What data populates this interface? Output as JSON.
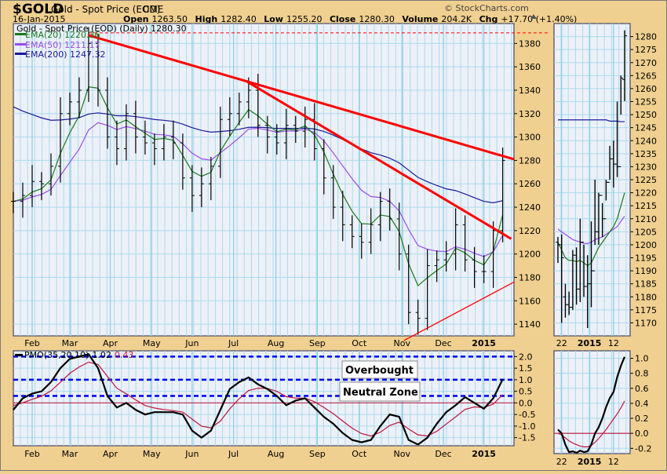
{
  "header": {
    "symbol": "$GOLD",
    "name": "Gold - Spot Price (EOD)",
    "exchange": "CME",
    "date": "16-Jan-2015",
    "copyright": "© StockCharts.com",
    "open_label": "Open",
    "open": "1263.50",
    "high_label": "High",
    "high": "1282.40",
    "low_label": "Low",
    "low": "1255.20",
    "close_label": "Close",
    "close": "1280.30",
    "volume_label": "Volume",
    "volume": "204.2K",
    "chg_label": "Chg",
    "chg": "+17.70 (+1.40%)",
    "chg_icon": "up-triangle-icon"
  },
  "colors": {
    "bg": "#f0d090",
    "panel": "#eef0f8",
    "ema20": "#1a7a1a",
    "ema50": "#9a4ce8",
    "ema200": "#1a1a9a",
    "trend": "#ff0000",
    "pmo": "#000000",
    "signal": "#c0143c",
    "zone": "#0000ee"
  },
  "chart_data": [
    {
      "type": "ohlc",
      "title": "Gold - Spot Price (EOD) (Daily) 1280.30",
      "legend": [
        "EMA(20) 1220.36",
        "EMA(50) 1211.17",
        "EMA(200) 1247.32"
      ],
      "legend_placement": "top-left",
      "x_ticks": [
        {
          "i": 2,
          "label": "Feb"
        },
        {
          "i": 6,
          "label": "Mar"
        },
        {
          "i": 10.3,
          "label": "Apr"
        },
        {
          "i": 14.7,
          "label": "May"
        },
        {
          "i": 19,
          "label": "Jun"
        },
        {
          "i": 23.4,
          "label": "Jul"
        },
        {
          "i": 27.9,
          "label": "Aug"
        },
        {
          "i": 32.3,
          "label": "Sep"
        },
        {
          "i": 36.75,
          "label": "Oct"
        },
        {
          "i": 41.3,
          "label": "Nov"
        },
        {
          "i": 45.7,
          "label": "Dec"
        },
        {
          "i": 50,
          "label": "2015"
        }
      ],
      "x_range": [
        0,
        53.2
      ],
      "ylim": [
        1130,
        1397
      ],
      "y_ticks": [
        1140,
        1160,
        1180,
        1200,
        1220,
        1240,
        1260,
        1280,
        1300,
        1320,
        1340,
        1360,
        1380
      ],
      "weekly_close": [
        1245,
        1250,
        1262,
        1260,
        1275,
        1320,
        1330,
        1340,
        1380,
        1340,
        1300,
        1290,
        1320,
        1300,
        1295,
        1290,
        1300,
        1295,
        1265,
        1250,
        1260,
        1275,
        1315,
        1320,
        1330,
        1340,
        1310,
        1300,
        1295,
        1310,
        1305,
        1315,
        1290,
        1265,
        1240,
        1225,
        1215,
        1210,
        1225,
        1245,
        1230,
        1200,
        1150,
        1145,
        1190,
        1195,
        1200,
        1225,
        1195,
        1185,
        1185,
        1220,
        1280
      ],
      "ema_seed": {
        "ema20": 1245,
        "ema50": 1245,
        "ema200": 1330
      },
      "ema_periods_weeks": {
        "ema20": 4,
        "ema50": 10,
        "ema200": 40
      },
      "trendlines": [
        {
          "from": [
            8,
            1387
          ],
          "to": [
            53.2,
            1281
          ],
          "width": "thick"
        },
        {
          "from": [
            24.7,
            1348
          ],
          "to": [
            52.9,
            1213
          ],
          "width": "thick"
        },
        {
          "from": [
            41.5,
            1126
          ],
          "to": [
            53.2,
            1176
          ],
          "width": "thin"
        }
      ],
      "dashed_level": 1389
    },
    {
      "type": "line",
      "title": "PMO(35,20,10)",
      "pmo_value": "1.02",
      "signal_value": "0.43",
      "ylim": [
        -1.85,
        2.25
      ],
      "y_ticks": [
        -1.5,
        -1.0,
        -0.5,
        0.0,
        0.5,
        1.0,
        1.5,
        2.0
      ],
      "zone_lines": [
        2.0,
        1.0,
        0.3
      ],
      "annotations": [
        "Overbought",
        "Neutral Zone"
      ],
      "pmo": [
        -0.3,
        0.2,
        0.4,
        0.5,
        0.9,
        1.5,
        1.9,
        2.0,
        2.1,
        1.5,
        0.3,
        -0.2,
        0.0,
        -0.3,
        -0.5,
        -0.4,
        -0.4,
        -0.4,
        -0.5,
        -1.2,
        -1.5,
        -1.2,
        -0.3,
        0.6,
        0.9,
        1.1,
        0.8,
        0.6,
        0.3,
        -0.1,
        0.1,
        0.2,
        -0.2,
        -0.6,
        -0.9,
        -1.3,
        -1.6,
        -1.7,
        -1.6,
        -1.0,
        -0.5,
        -0.6,
        -1.6,
        -1.8,
        -1.5,
        -0.9,
        -0.4,
        -0.1,
        0.25,
        0.0,
        -0.25,
        0.2,
        1.02
      ]
    },
    {
      "type": "ohlc",
      "title": "Gold daily detail",
      "x_ticks": [
        {
          "i": 1,
          "label": "22"
        },
        {
          "i": 8.5,
          "label": "2015"
        },
        {
          "i": 15,
          "label": "12"
        }
      ],
      "ylim": [
        1165,
        1285
      ],
      "y_ticks": [
        1170,
        1175,
        1180,
        1185,
        1190,
        1195,
        1200,
        1205,
        1210,
        1215,
        1220,
        1225,
        1230,
        1235,
        1240,
        1245,
        1250,
        1255,
        1260,
        1265,
        1270,
        1275,
        1280
      ],
      "bars": [
        [
          1201,
          1203,
          1193,
          1200
        ],
        [
          1200,
          1204,
          1170,
          1195
        ],
        [
          1180,
          1185,
          1172,
          1177
        ],
        [
          1177,
          1182,
          1173,
          1176
        ],
        [
          1176,
          1198,
          1175,
          1196
        ],
        [
          1196,
          1199,
          1177,
          1183
        ],
        [
          1183,
          1210,
          1178,
          1201
        ],
        [
          1201,
          1200,
          1180,
          1184
        ],
        [
          1184,
          1196,
          1168,
          1185
        ],
        [
          1185,
          1209,
          1176,
          1190
        ],
        [
          1190,
          1225,
          1200,
          1205
        ],
        [
          1205,
          1220,
          1200,
          1219
        ],
        [
          1219,
          1216,
          1203,
          1210
        ],
        [
          1210,
          1225,
          1217,
          1224
        ],
        [
          1224,
          1238,
          1225,
          1233
        ],
        [
          1233,
          1240,
          1222,
          1231
        ],
        [
          1231,
          1255,
          1226,
          1230
        ],
        [
          1230,
          1265,
          1250,
          1264
        ],
        [
          1263.5,
          1282.4,
          1255.2,
          1280.3
        ]
      ],
      "ema20": [
        1201,
        1198,
        1195,
        1194,
        1194,
        1193.5,
        1194,
        1193,
        1192,
        1193,
        1196,
        1199,
        1201,
        1203,
        1205,
        1207,
        1210,
        1215,
        1220
      ],
      "ema50": [
        1206,
        1205,
        1204,
        1203,
        1202,
        1201.5,
        1201,
        1200.5,
        1200.5,
        1201,
        1202,
        1202.5,
        1203,
        1204,
        1205,
        1206,
        1207,
        1209,
        1211
      ],
      "ema200": [
        1248,
        1248,
        1248,
        1248,
        1248,
        1248,
        1248,
        1248,
        1248,
        1248,
        1248,
        1248,
        1248,
        1248,
        1247.5,
        1247.5,
        1247.5,
        1247.3,
        1247.3
      ]
    },
    {
      "type": "line",
      "title": "PMO daily detail",
      "ylim": [
        -0.27,
        1.1
      ],
      "y_ticks": [
        -0.2,
        0.0,
        0.2,
        0.4,
        0.6,
        0.8,
        1.0
      ],
      "pmo": [
        0.05,
        0.0,
        -0.15,
        -0.25,
        -0.24,
        -0.26,
        -0.23,
        -0.25,
        -0.24,
        -0.15,
        0.0,
        0.08,
        0.2,
        0.35,
        0.47,
        0.55,
        0.75,
        0.9,
        1.02
      ],
      "signal": [
        0.0,
        -0.02,
        -0.06,
        -0.1,
        -0.13,
        -0.15,
        -0.17,
        -0.18,
        -0.18,
        -0.16,
        -0.12,
        -0.07,
        -0.01,
        0.05,
        0.12,
        0.19,
        0.26,
        0.34,
        0.43
      ]
    }
  ]
}
